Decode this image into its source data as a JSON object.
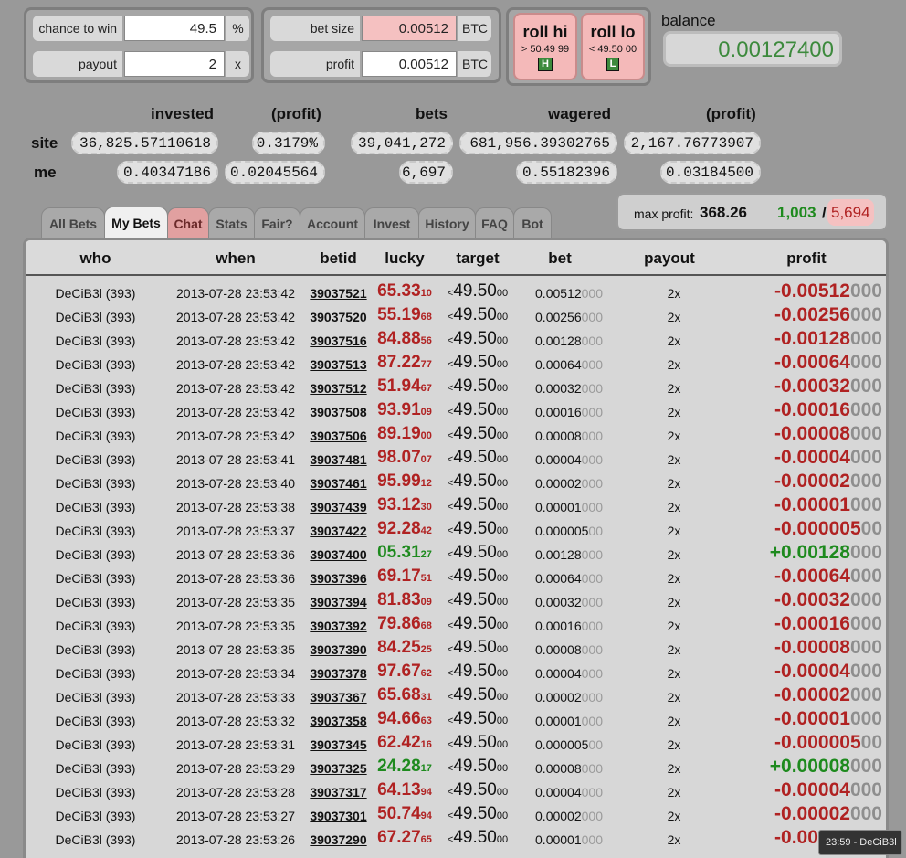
{
  "controls": {
    "chance": {
      "label": "chance to win",
      "value": "49.5",
      "unit": "%"
    },
    "payout": {
      "label": "payout",
      "value": "2",
      "unit": "x"
    },
    "betsize": {
      "label": "bet size",
      "value": "0.00512",
      "unit": "BTC"
    },
    "profit": {
      "label": "profit",
      "value": "0.00512",
      "unit": "BTC"
    }
  },
  "roll_hi": {
    "label": "roll hi",
    "sub": "> 50.49 99",
    "key": "H"
  },
  "roll_lo": {
    "label": "roll lo",
    "sub": "< 49.50 00",
    "key": "L"
  },
  "balance": {
    "label": "balance",
    "value": "0.00127400"
  },
  "stats": {
    "headers": {
      "invested": "invested",
      "profit1": "(profit)",
      "bets": "bets",
      "wagered": "wagered",
      "profit2": "(profit)"
    },
    "site": {
      "label": "site",
      "invested": "36,825.57110618",
      "profit1": "0.3179%",
      "bets": "39,041,272",
      "wagered": "681,956.39302765",
      "profit2": "2,167.76773907"
    },
    "me": {
      "label": "me",
      "invested": "0.40347186",
      "profit1": "0.02045564",
      "bets": "6,697",
      "wagered": "0.55182396",
      "profit2": "0.03184500"
    }
  },
  "tabs": [
    "All Bets",
    "My Bets",
    "Chat",
    "Stats",
    "Fair?",
    "Account",
    "Invest",
    "History",
    "FAQ",
    "Bot"
  ],
  "max_profit": {
    "label": "max profit:",
    "value": "368.26",
    "wins": "1,003",
    "sep": "/",
    "losses": "5,694"
  },
  "table": {
    "headers": {
      "who": "who",
      "when": "when",
      "betid": "betid",
      "lucky": "lucky",
      "target": "target",
      "bet": "bet",
      "payout": "payout",
      "profit": "profit"
    },
    "rows": [
      {
        "who": "DeCiB3l (393)",
        "when": "2013-07-28 23:53:42",
        "betid": "39037521",
        "lucky": "65.33",
        "lucky_s": "10",
        "win": false,
        "bet": "0.00512",
        "bet_z": "000",
        "payout": "2x",
        "profit": "-0.00512",
        "profit_z": "000"
      },
      {
        "who": "DeCiB3l (393)",
        "when": "2013-07-28 23:53:42",
        "betid": "39037520",
        "lucky": "55.19",
        "lucky_s": "68",
        "win": false,
        "bet": "0.00256",
        "bet_z": "000",
        "payout": "2x",
        "profit": "-0.00256",
        "profit_z": "000"
      },
      {
        "who": "DeCiB3l (393)",
        "when": "2013-07-28 23:53:42",
        "betid": "39037516",
        "lucky": "84.88",
        "lucky_s": "56",
        "win": false,
        "bet": "0.00128",
        "bet_z": "000",
        "payout": "2x",
        "profit": "-0.00128",
        "profit_z": "000"
      },
      {
        "who": "DeCiB3l (393)",
        "when": "2013-07-28 23:53:42",
        "betid": "39037513",
        "lucky": "87.22",
        "lucky_s": "77",
        "win": false,
        "bet": "0.00064",
        "bet_z": "000",
        "payout": "2x",
        "profit": "-0.00064",
        "profit_z": "000"
      },
      {
        "who": "DeCiB3l (393)",
        "when": "2013-07-28 23:53:42",
        "betid": "39037512",
        "lucky": "51.94",
        "lucky_s": "67",
        "win": false,
        "bet": "0.00032",
        "bet_z": "000",
        "payout": "2x",
        "profit": "-0.00032",
        "profit_z": "000"
      },
      {
        "who": "DeCiB3l (393)",
        "when": "2013-07-28 23:53:42",
        "betid": "39037508",
        "lucky": "93.91",
        "lucky_s": "09",
        "win": false,
        "bet": "0.00016",
        "bet_z": "000",
        "payout": "2x",
        "profit": "-0.00016",
        "profit_z": "000"
      },
      {
        "who": "DeCiB3l (393)",
        "when": "2013-07-28 23:53:42",
        "betid": "39037506",
        "lucky": "89.19",
        "lucky_s": "00",
        "win": false,
        "bet": "0.00008",
        "bet_z": "000",
        "payout": "2x",
        "profit": "-0.00008",
        "profit_z": "000"
      },
      {
        "who": "DeCiB3l (393)",
        "when": "2013-07-28 23:53:41",
        "betid": "39037481",
        "lucky": "98.07",
        "lucky_s": "07",
        "win": false,
        "bet": "0.00004",
        "bet_z": "000",
        "payout": "2x",
        "profit": "-0.00004",
        "profit_z": "000"
      },
      {
        "who": "DeCiB3l (393)",
        "when": "2013-07-28 23:53:40",
        "betid": "39037461",
        "lucky": "95.99",
        "lucky_s": "12",
        "win": false,
        "bet": "0.00002",
        "bet_z": "000",
        "payout": "2x",
        "profit": "-0.00002",
        "profit_z": "000"
      },
      {
        "who": "DeCiB3l (393)",
        "when": "2013-07-28 23:53:38",
        "betid": "39037439",
        "lucky": "93.12",
        "lucky_s": "30",
        "win": false,
        "bet": "0.00001",
        "bet_z": "000",
        "payout": "2x",
        "profit": "-0.00001",
        "profit_z": "000"
      },
      {
        "who": "DeCiB3l (393)",
        "when": "2013-07-28 23:53:37",
        "betid": "39037422",
        "lucky": "92.28",
        "lucky_s": "42",
        "win": false,
        "bet": "0.000005",
        "bet_z": "00",
        "payout": "2x",
        "profit": "-0.000005",
        "profit_z": "00"
      },
      {
        "who": "DeCiB3l (393)",
        "when": "2013-07-28 23:53:36",
        "betid": "39037400",
        "lucky": "05.31",
        "lucky_s": "27",
        "win": true,
        "bet": "0.00128",
        "bet_z": "000",
        "payout": "2x",
        "profit": "+0.00128",
        "profit_z": "000"
      },
      {
        "who": "DeCiB3l (393)",
        "when": "2013-07-28 23:53:36",
        "betid": "39037396",
        "lucky": "69.17",
        "lucky_s": "51",
        "win": false,
        "bet": "0.00064",
        "bet_z": "000",
        "payout": "2x",
        "profit": "-0.00064",
        "profit_z": "000"
      },
      {
        "who": "DeCiB3l (393)",
        "when": "2013-07-28 23:53:35",
        "betid": "39037394",
        "lucky": "81.83",
        "lucky_s": "09",
        "win": false,
        "bet": "0.00032",
        "bet_z": "000",
        "payout": "2x",
        "profit": "-0.00032",
        "profit_z": "000"
      },
      {
        "who": "DeCiB3l (393)",
        "when": "2013-07-28 23:53:35",
        "betid": "39037392",
        "lucky": "79.86",
        "lucky_s": "68",
        "win": false,
        "bet": "0.00016",
        "bet_z": "000",
        "payout": "2x",
        "profit": "-0.00016",
        "profit_z": "000"
      },
      {
        "who": "DeCiB3l (393)",
        "when": "2013-07-28 23:53:35",
        "betid": "39037390",
        "lucky": "84.25",
        "lucky_s": "25",
        "win": false,
        "bet": "0.00008",
        "bet_z": "000",
        "payout": "2x",
        "profit": "-0.00008",
        "profit_z": "000"
      },
      {
        "who": "DeCiB3l (393)",
        "when": "2013-07-28 23:53:34",
        "betid": "39037378",
        "lucky": "97.67",
        "lucky_s": "62",
        "win": false,
        "bet": "0.00004",
        "bet_z": "000",
        "payout": "2x",
        "profit": "-0.00004",
        "profit_z": "000"
      },
      {
        "who": "DeCiB3l (393)",
        "when": "2013-07-28 23:53:33",
        "betid": "39037367",
        "lucky": "65.68",
        "lucky_s": "31",
        "win": false,
        "bet": "0.00002",
        "bet_z": "000",
        "payout": "2x",
        "profit": "-0.00002",
        "profit_z": "000"
      },
      {
        "who": "DeCiB3l (393)",
        "when": "2013-07-28 23:53:32",
        "betid": "39037358",
        "lucky": "94.66",
        "lucky_s": "63",
        "win": false,
        "bet": "0.00001",
        "bet_z": "000",
        "payout": "2x",
        "profit": "-0.00001",
        "profit_z": "000"
      },
      {
        "who": "DeCiB3l (393)",
        "when": "2013-07-28 23:53:31",
        "betid": "39037345",
        "lucky": "62.42",
        "lucky_s": "16",
        "win": false,
        "bet": "0.000005",
        "bet_z": "00",
        "payout": "2x",
        "profit": "-0.000005",
        "profit_z": "00"
      },
      {
        "who": "DeCiB3l (393)",
        "when": "2013-07-28 23:53:29",
        "betid": "39037325",
        "lucky": "24.28",
        "lucky_s": "17",
        "win": true,
        "bet": "0.00008",
        "bet_z": "000",
        "payout": "2x",
        "profit": "+0.00008",
        "profit_z": "000"
      },
      {
        "who": "DeCiB3l (393)",
        "when": "2013-07-28 23:53:28",
        "betid": "39037317",
        "lucky": "64.13",
        "lucky_s": "94",
        "win": false,
        "bet": "0.00004",
        "bet_z": "000",
        "payout": "2x",
        "profit": "-0.00004",
        "profit_z": "000"
      },
      {
        "who": "DeCiB3l (393)",
        "when": "2013-07-28 23:53:27",
        "betid": "39037301",
        "lucky": "50.74",
        "lucky_s": "94",
        "win": false,
        "bet": "0.00002",
        "bet_z": "000",
        "payout": "2x",
        "profit": "-0.00002",
        "profit_z": "000"
      },
      {
        "who": "DeCiB3l (393)",
        "when": "2013-07-28 23:53:26",
        "betid": "39037290",
        "lucky": "67.27",
        "lucky_s": "65",
        "win": false,
        "bet": "0.00001",
        "bet_z": "000",
        "payout": "2x",
        "profit": "-0.00001",
        "profit_z": "000"
      }
    ],
    "target_prefix": "<",
    "target_main": "49.50",
    "target_small": "00"
  },
  "tooltip": "23:59 - DeCiB3l",
  "colors": {
    "win": "#1e8a1e",
    "loss": "#b02222",
    "balance": "#3d8a3d"
  }
}
